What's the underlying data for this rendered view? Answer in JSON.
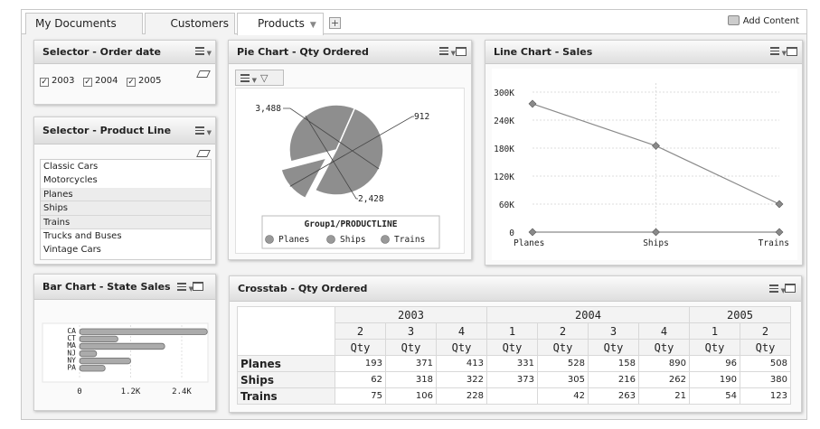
{
  "tabs": [
    {
      "label": "My Documents"
    },
    {
      "label": "Customers"
    },
    {
      "label": "Products"
    }
  ],
  "add_content": "Add Content",
  "order_date_selector": {
    "title": "Selector - Order date",
    "options": [
      {
        "label": "2003",
        "checked": true
      },
      {
        "label": "2004",
        "checked": true
      },
      {
        "label": "2005",
        "checked": true
      }
    ]
  },
  "product_line_selector": {
    "title": "Selector - Product Line",
    "items": [
      "Classic Cars",
      "Motorcycles",
      "Planes",
      "Ships",
      "Trains",
      "Trucks and Buses",
      "Vintage Cars"
    ],
    "selected": [
      "Planes",
      "Ships",
      "Trains"
    ]
  },
  "pie_panel": {
    "title": "Pie Chart - Qty Ordered"
  },
  "line_panel": {
    "title": "Line Chart - Sales"
  },
  "bar_panel": {
    "title": "Bar Chart - State Sales"
  },
  "crosstab": {
    "title": "Crosstab - Qty Ordered",
    "years": [
      {
        "label": "2003",
        "quarters": [
          "2",
          "3",
          "4"
        ]
      },
      {
        "label": "2004",
        "quarters": [
          "1",
          "2",
          "3",
          "4"
        ]
      },
      {
        "label": "2005",
        "quarters": [
          "1",
          "2"
        ]
      }
    ],
    "measure": "Qty",
    "rows": [
      {
        "label": "Planes",
        "values": [
          "193",
          "371",
          "413",
          "331",
          "528",
          "158",
          "890",
          "96",
          "508"
        ]
      },
      {
        "label": "Ships",
        "values": [
          "62",
          "318",
          "322",
          "373",
          "305",
          "216",
          "262",
          "190",
          "380"
        ]
      },
      {
        "label": "Trains",
        "values": [
          "75",
          "106",
          "228",
          "",
          "42",
          "263",
          "21",
          "54",
          "123"
        ]
      }
    ]
  },
  "chart_data": [
    {
      "type": "pie",
      "title": "",
      "legend_title": "Group1/PRODUCTLINE",
      "categories": [
        "Planes",
        "Ships",
        "Trains"
      ],
      "values": [
        3488,
        912,
        2428
      ],
      "data_labels": [
        "3,488",
        "912",
        "2,428"
      ],
      "exploded": [
        "Ships"
      ],
      "color": "#8c8c8c",
      "legend_position": "bottom"
    },
    {
      "type": "line",
      "title": "",
      "categories": [
        "Planes",
        "Ships",
        "Trains"
      ],
      "series": [
        {
          "values": [
            275000,
            185000,
            60000
          ]
        },
        {
          "values": [
            0,
            0,
            0
          ]
        }
      ],
      "ytick_labels": [
        "0",
        "60K",
        "120K",
        "180K",
        "240K",
        "300K"
      ],
      "ylim": [
        0,
        300000
      ],
      "grid": true
    },
    {
      "type": "bar",
      "orientation": "horizontal",
      "title": "",
      "categories": [
        "CA",
        "CT",
        "MA",
        "NJ",
        "NY",
        "PA"
      ],
      "values": [
        3000,
        900,
        2000,
        400,
        1200,
        600
      ],
      "xtick_labels": [
        "0",
        "1.2K",
        "2.4K"
      ],
      "xlim": [
        0,
        3600
      ]
    }
  ]
}
